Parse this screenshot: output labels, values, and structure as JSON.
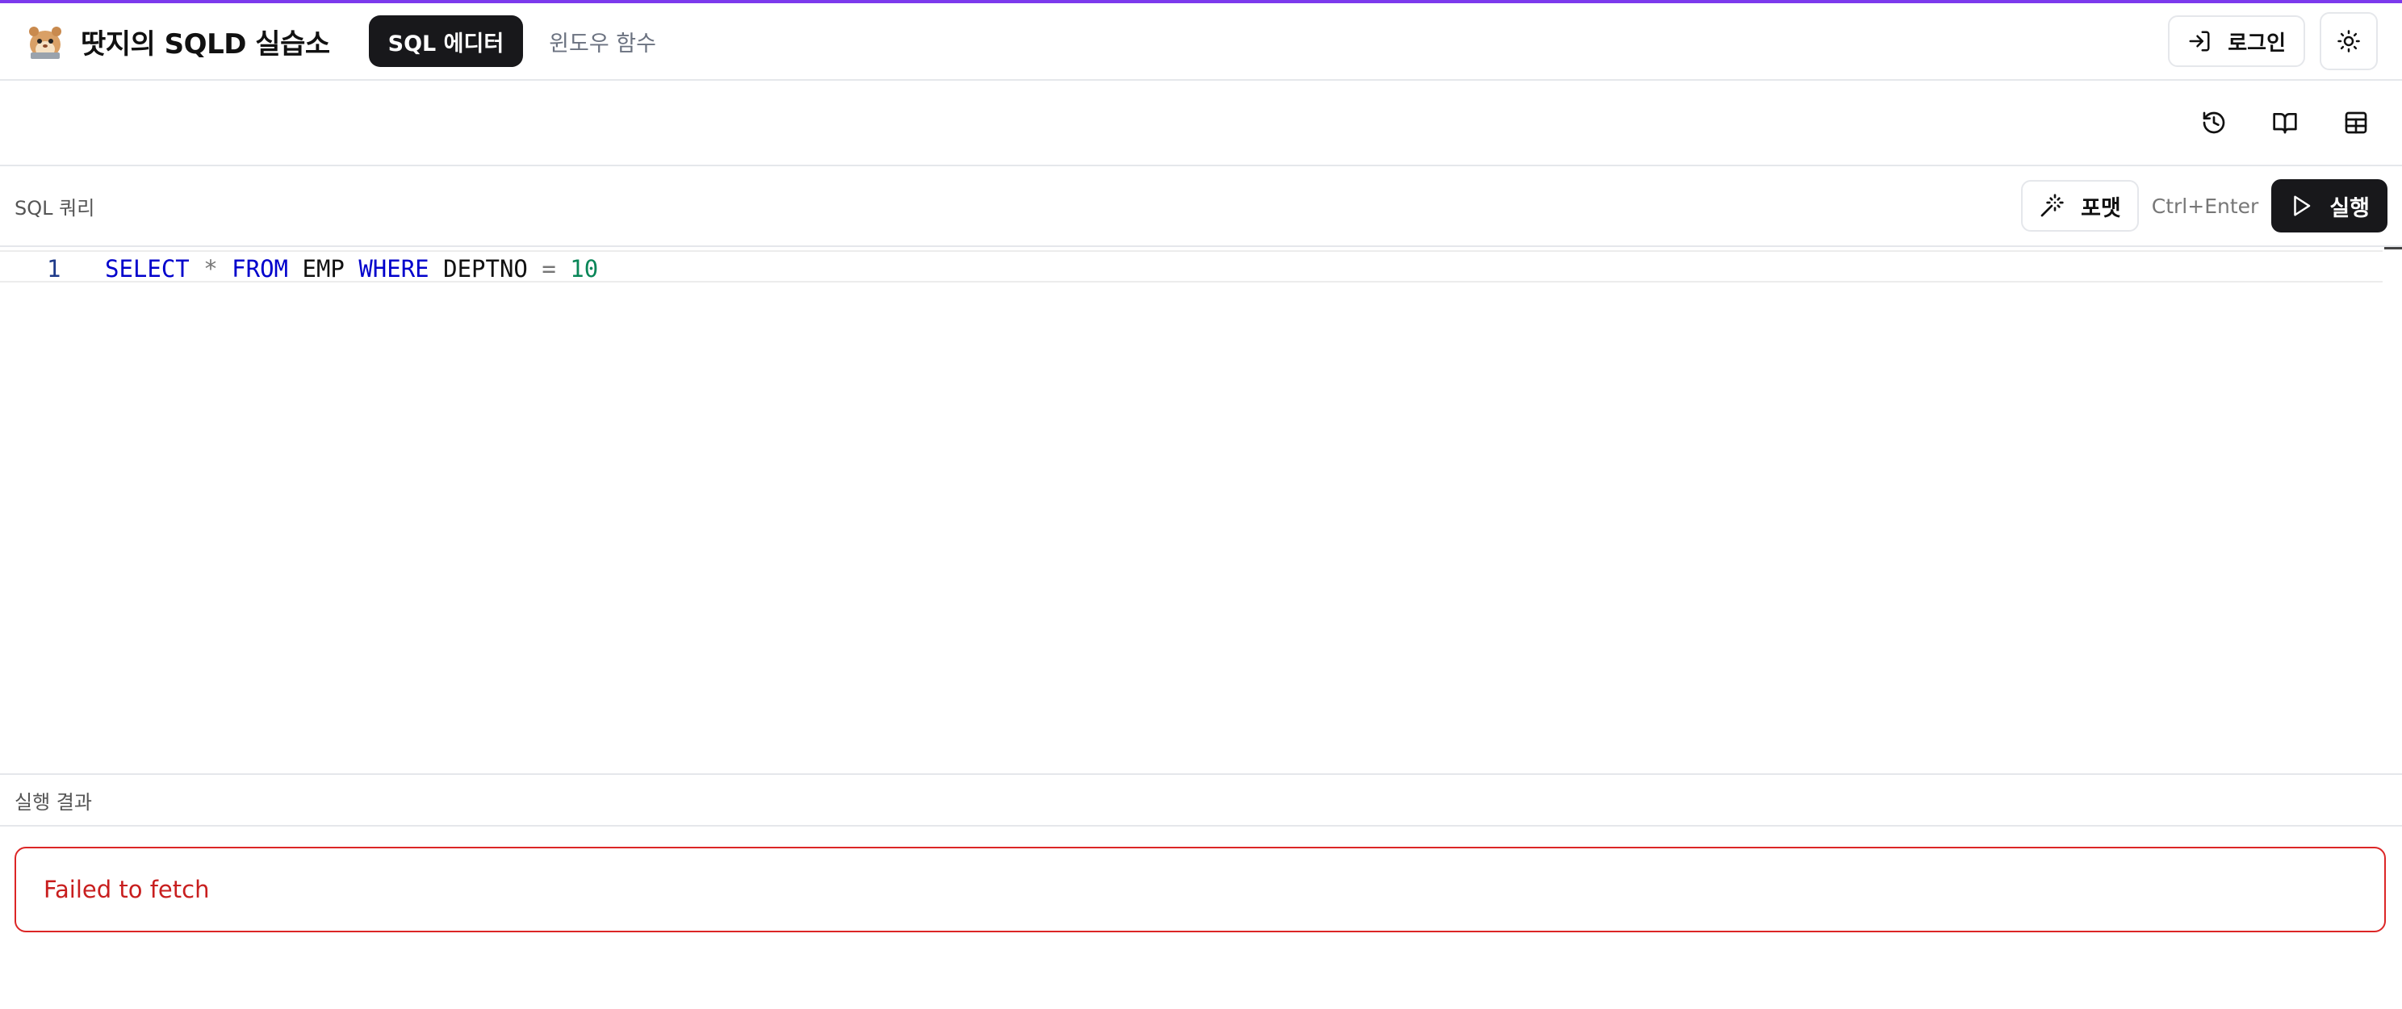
{
  "colors": {
    "accent": "#7c3aed",
    "primary_button": "#18181b",
    "error": "#dc2626",
    "keyword": "#0000cc",
    "number": "#098658"
  },
  "header": {
    "title": "땃지의 SQLD 실습소",
    "logo_icon": "hamster-logo-icon",
    "nav": [
      {
        "label": "SQL 에디터",
        "active": true
      },
      {
        "label": "윈도우 함수",
        "active": false
      }
    ],
    "login_label": "로그인",
    "login_icon": "log-in-icon",
    "theme_icon": "sun-icon"
  },
  "toolbar": {
    "icons": [
      "history-icon",
      "book-open-icon",
      "table-icon"
    ]
  },
  "query": {
    "label": "SQL 쿼리",
    "format_label": "포맷",
    "format_icon": "magic-wand-icon",
    "shortcut": "Ctrl+Enter",
    "run_label": "실행",
    "run_icon": "play-icon"
  },
  "editor": {
    "line_number": "1",
    "tokens": {
      "select": "SELECT",
      "star": "*",
      "from": "FROM",
      "table": "EMP",
      "where": "WHERE",
      "column": "DEPTNO",
      "eq": "=",
      "value": "10"
    }
  },
  "results": {
    "label": "실행 결과",
    "error_message": "Failed to fetch"
  }
}
